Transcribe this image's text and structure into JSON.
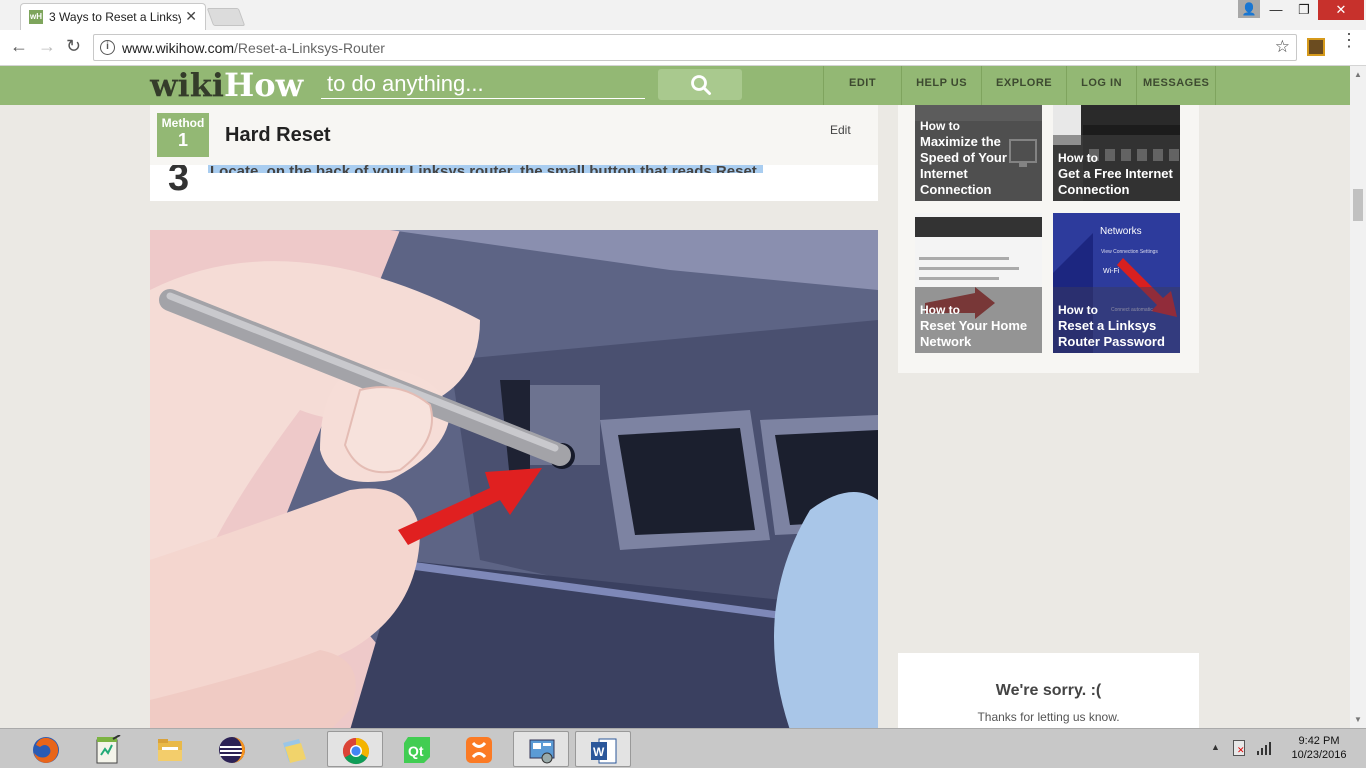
{
  "browser": {
    "tab_title": "3 Ways to Reset a Linksys",
    "tab_favicon": "wH",
    "url_host": "www.wikihow.com",
    "url_path": "/Reset-a-Linksys-Router"
  },
  "wikihow": {
    "logo_wiki": "wiki",
    "logo_how": "How",
    "search_placeholder": "to do anything...",
    "nav": [
      "EDIT",
      "HELP US",
      "EXPLORE",
      "LOG IN",
      "MESSAGES"
    ],
    "brand_color": "#93b874"
  },
  "article": {
    "method_label": "Method",
    "method_number": "1",
    "method_title": "Hard Reset",
    "edit_label": "Edit",
    "step_number": "3",
    "step_text": "Locate, on the back of your Linksys router, the small button that reads Reset."
  },
  "related": [
    {
      "howto": "How to",
      "title": "Maximize the Speed of Your Internet Connection"
    },
    {
      "howto": "How to",
      "title": "Get a Free Internet Connection"
    },
    {
      "howto": "How to",
      "title": "Reset Your Home Network"
    },
    {
      "howto": "How to",
      "title": "Reset a Linksys Router Password"
    }
  ],
  "related_thumb_text": {
    "networks": "Networks",
    "view_settings": "View Connection Settings",
    "wifi": "Wi-Fi",
    "connect_auto": "Connect automatic"
  },
  "sorry": {
    "title": "We're sorry. :(",
    "text": "Thanks for letting us know."
  },
  "taskbar": {
    "apps": [
      "firefox-icon",
      "notepad-icon",
      "file-explorer-icon",
      "eclipse-icon",
      "folder-icon",
      "chrome-icon",
      "qt-creator-icon",
      "xampp-icon",
      "control-panel-icon",
      "word-icon"
    ],
    "active_app": "chrome-icon",
    "time": "9:42 PM",
    "date": "10/23/2016"
  }
}
